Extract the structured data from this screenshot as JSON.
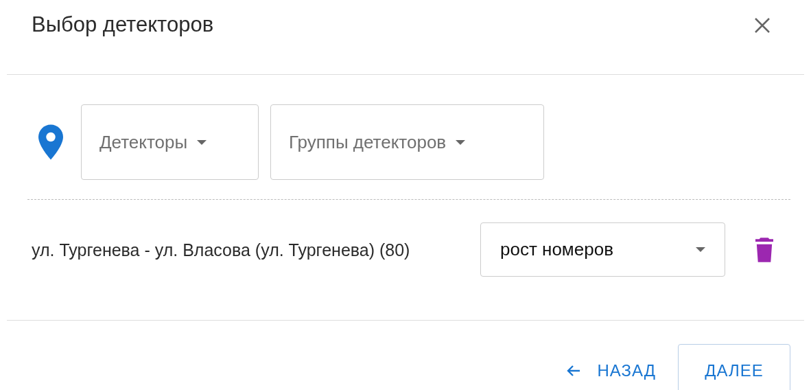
{
  "dialog": {
    "title": "Выбор детекторов"
  },
  "filters": [
    {
      "kind": "select",
      "label": "Детекторы"
    },
    {
      "kind": "select",
      "label": "Группы детекторов"
    }
  ],
  "detectors": [
    {
      "name": "ул. Тургенева - ул. Власова (ул. Тургенева) (80)",
      "mode": "рост номеров"
    }
  ],
  "buttons": [
    {
      "kind": "text",
      "label": "НАЗАД"
    },
    {
      "kind": "outlined",
      "label": "ДАЛЕЕ"
    }
  ]
}
